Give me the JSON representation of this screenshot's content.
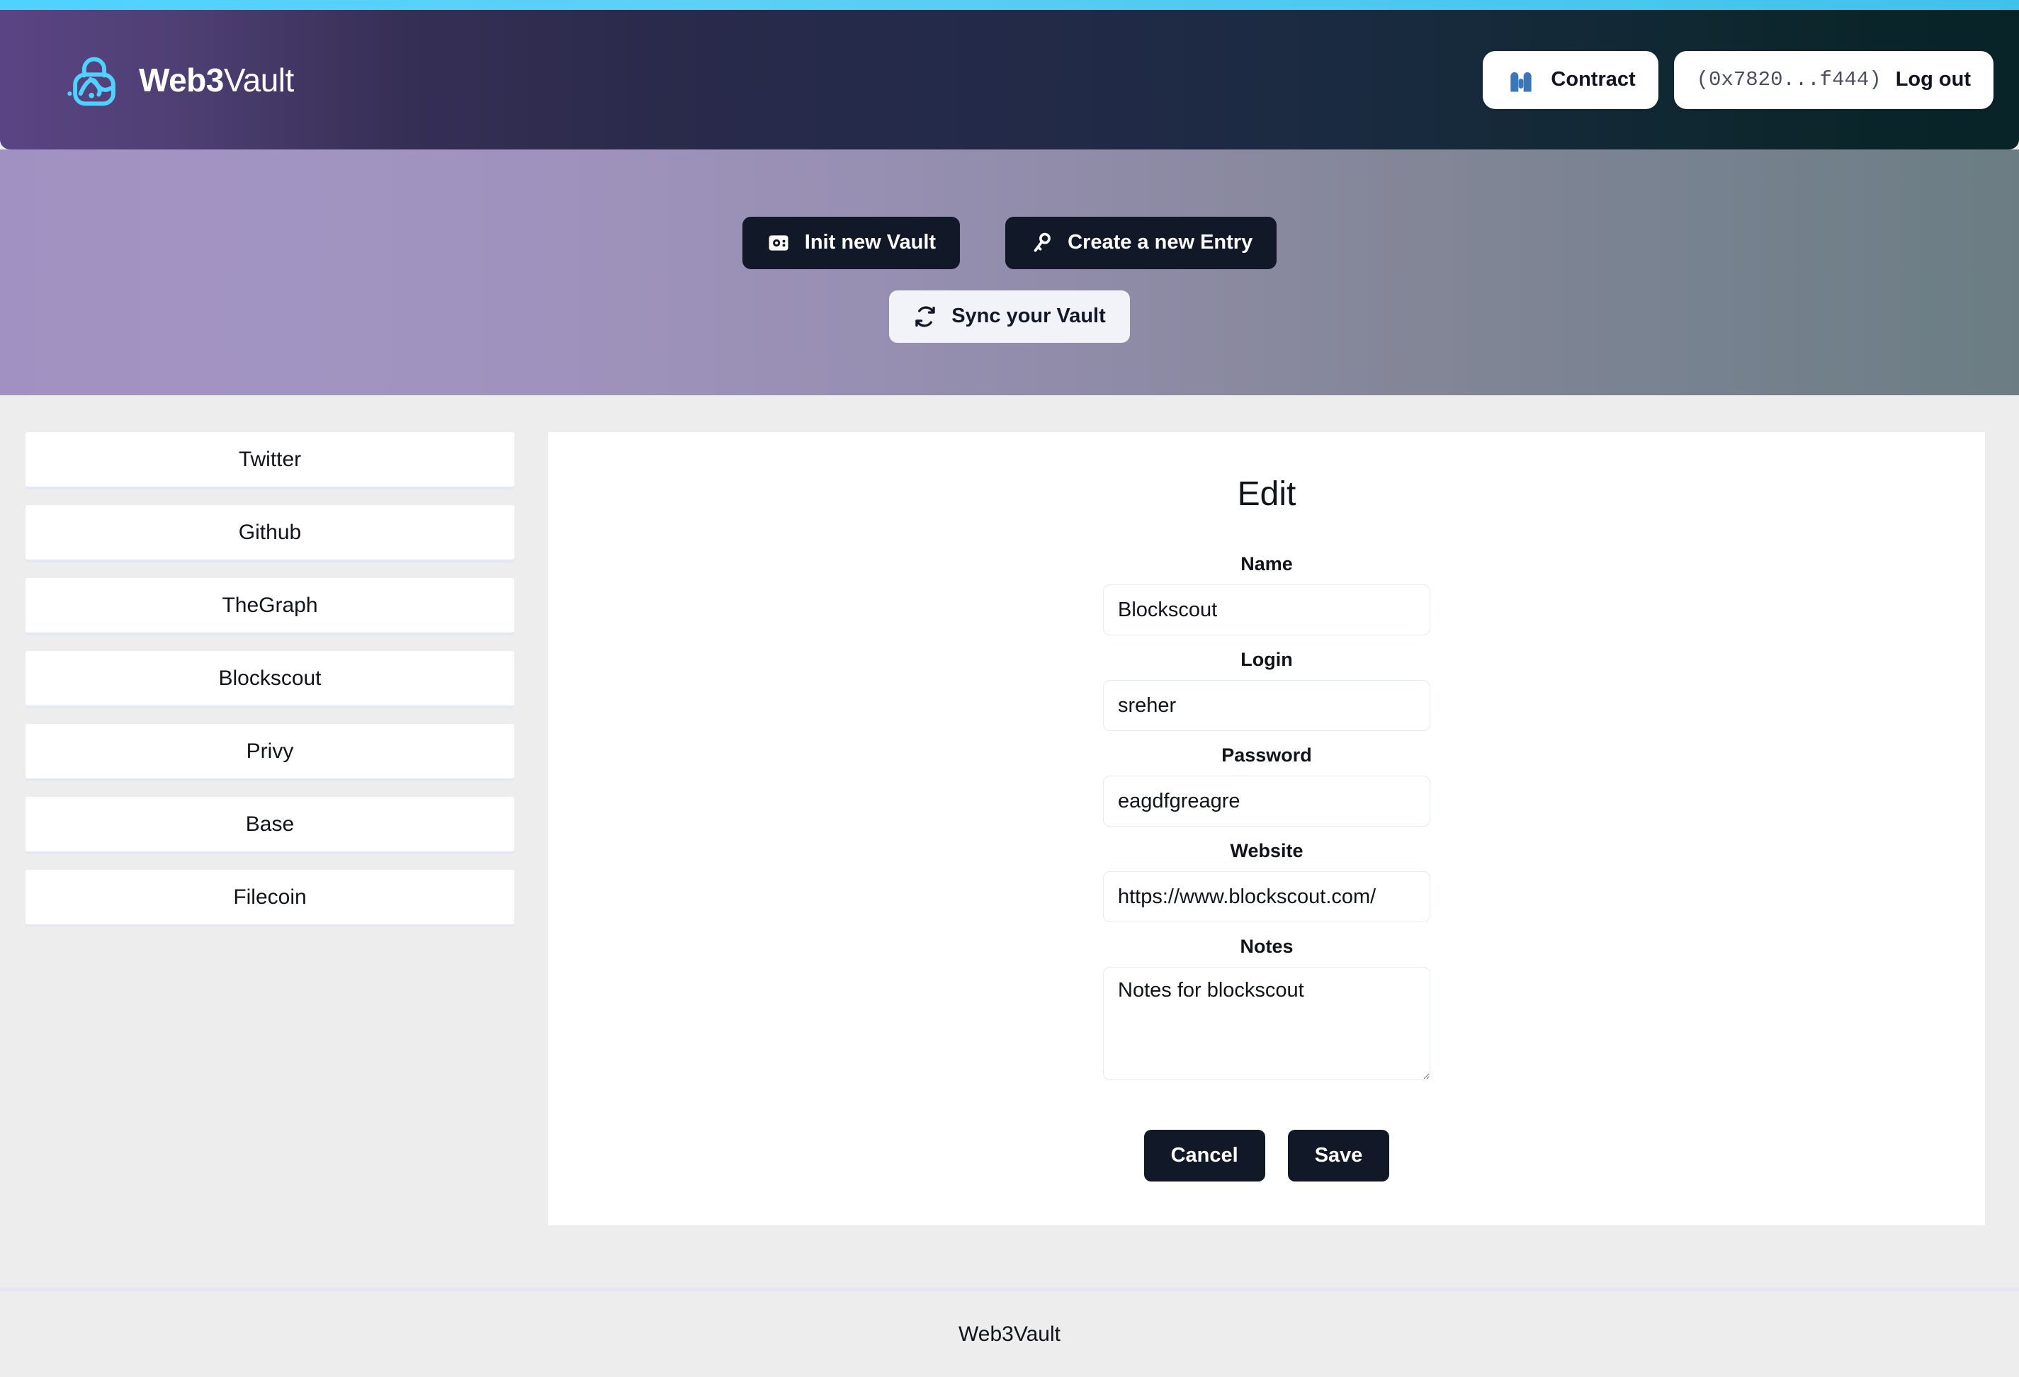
{
  "brand": {
    "name_bold": "Web3",
    "name_light": "Vault",
    "logo_icon": "padlock-atom-icon"
  },
  "header": {
    "contract": {
      "icon": "vault-contract-icon",
      "label": "Contract"
    },
    "account": {
      "address": "(0x7820...f444)",
      "logout_label": "Log out"
    }
  },
  "banner": {
    "init_vault": {
      "icon": "safe-icon",
      "label": "Init new Vault"
    },
    "create_entry": {
      "icon": "key-icon",
      "label": "Create a new Entry"
    },
    "sync_vault": {
      "icon": "sync-icon",
      "label": "Sync your Vault"
    }
  },
  "entries": [
    {
      "label": "Twitter"
    },
    {
      "label": "Github"
    },
    {
      "label": "TheGraph"
    },
    {
      "label": "Blockscout"
    },
    {
      "label": "Privy"
    },
    {
      "label": "Base"
    },
    {
      "label": "Filecoin"
    }
  ],
  "panel": {
    "title": "Edit",
    "fields": {
      "name": {
        "label": "Name",
        "value": "Blockscout",
        "placeholder": ""
      },
      "login": {
        "label": "Login",
        "value": "sreher",
        "placeholder": ""
      },
      "password": {
        "label": "Password",
        "value": "eagdfgreagre",
        "placeholder": ""
      },
      "website": {
        "label": "Website",
        "value": "https://www.blockscout.com/",
        "placeholder": ""
      },
      "notes": {
        "label": "Notes",
        "value": "Notes for blockscout",
        "placeholder": ""
      }
    },
    "cancel_label": "Cancel",
    "save_label": "Save"
  },
  "footer": {
    "text": "Web3Vault"
  },
  "colors": {
    "accent_cyan": "#4fd2ff",
    "header_left": "#5b4484",
    "header_right": "#082428",
    "banner_left": "#a191c2",
    "banner_right": "#6b7d83",
    "dark_button": "#111827",
    "contract_icon_blue": "#3b76b8",
    "page_bg": "#ededed"
  }
}
